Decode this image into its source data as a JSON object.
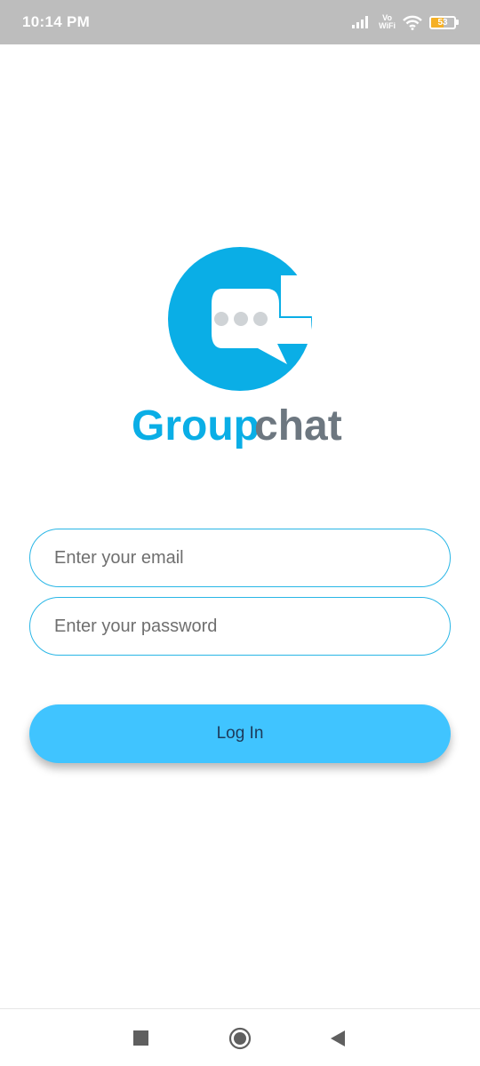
{
  "status_bar": {
    "time": "10:14 PM",
    "vowifi_top": "Vo",
    "vowifi_bottom": "WiFi",
    "battery_level": "53",
    "battery_fraction": 0.53,
    "icons": [
      "signal-icon",
      "vowifi-icon",
      "wifi-icon",
      "battery-icon"
    ]
  },
  "logo": {
    "word_1": "Group",
    "word_2": "chat",
    "colors": {
      "primary": "#0aaee6",
      "secondary": "#6d7780",
      "dots": "#cfd3d6"
    }
  },
  "login_form": {
    "email_placeholder": "Enter your email",
    "email_value": "",
    "password_placeholder": "Enter your password",
    "password_value": "",
    "login_label": "Log In"
  },
  "colors": {
    "input_border": "#29b6e6",
    "button_bg": "#40c4ff",
    "button_text": "#1d3a5a"
  },
  "nav_bar": {
    "icons": [
      "recent-apps-icon",
      "home-icon",
      "back-icon"
    ]
  }
}
